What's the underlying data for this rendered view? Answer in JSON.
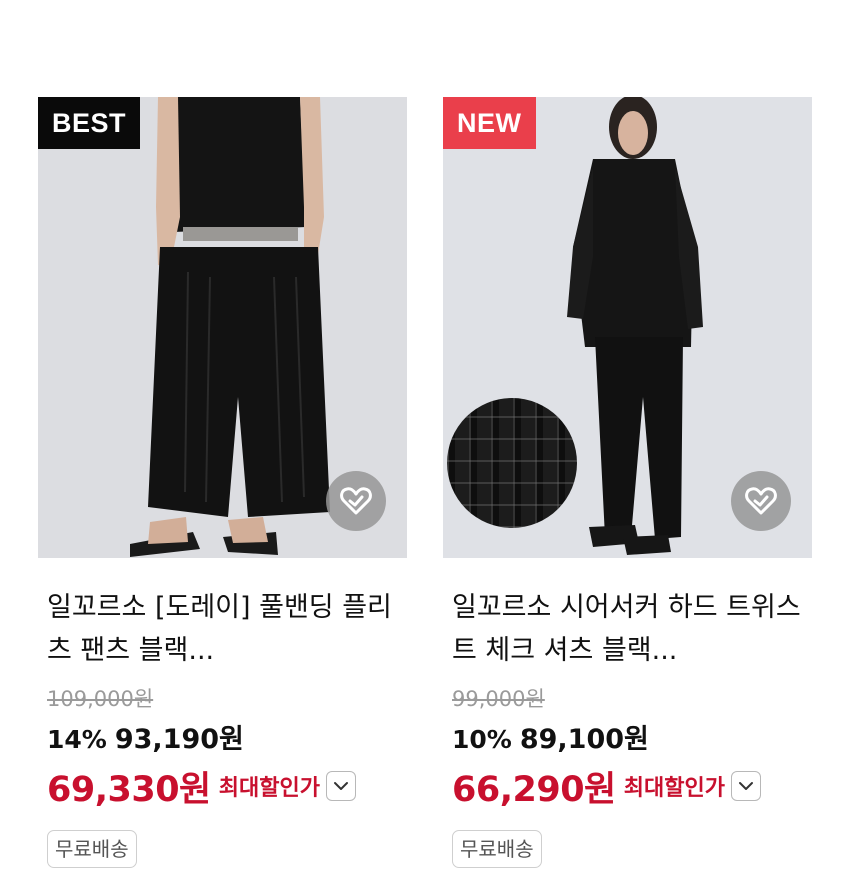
{
  "products": [
    {
      "badge": "BEST",
      "name": "일꼬르소 [도레이] 풀밴딩 플리츠 팬츠 블랙...",
      "original_price": "109,000원",
      "discount_rate": "14%",
      "sale_price": "93,190원",
      "max_price": "69,330원",
      "max_label": "최대할인가",
      "shipping": "무료배송"
    },
    {
      "badge": "NEW",
      "name": "일꼬르소 시어서커 하드 트위스트 체크 셔츠 블랙...",
      "original_price": "99,000원",
      "discount_rate": "10%",
      "sale_price": "89,100원",
      "max_price": "66,290원",
      "max_label": "최대할인가",
      "shipping": "무료배송"
    }
  ],
  "colors": {
    "best_badge": "#0a0a0a",
    "new_badge": "#ea3f4b",
    "max_price": "#c8102e"
  },
  "icons": {
    "wishlist": "heart-check-icon",
    "dropdown": "chevron-down-icon"
  }
}
